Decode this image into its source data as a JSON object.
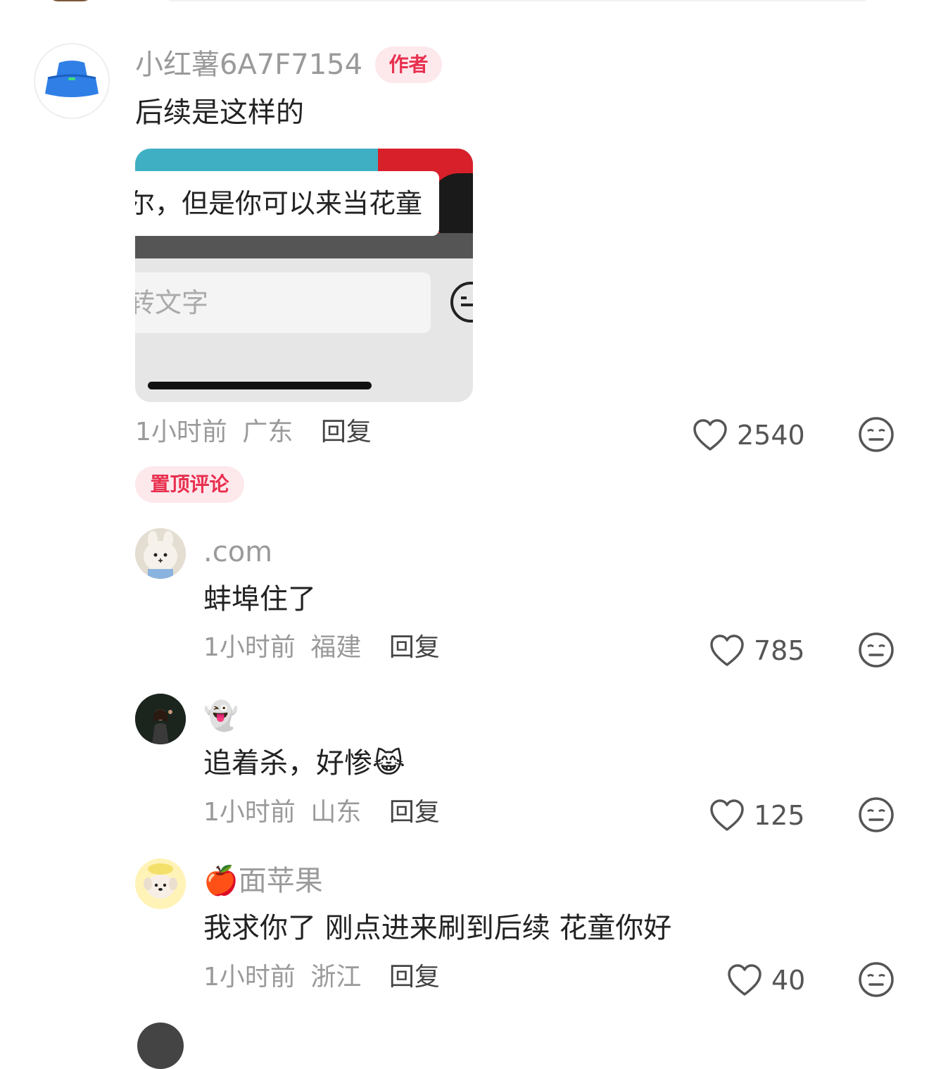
{
  "author_comment": {
    "name": "小红薯6A7F7154",
    "badge": "作者",
    "text": "后续是这样的",
    "image": {
      "bubble_text": "尔，但是你可以来当花童",
      "input_placeholder": "转文字"
    },
    "time": "1小时前",
    "location": "广东",
    "reply_label": "回复",
    "likes": "2540",
    "pinned_label": "置顶评论"
  },
  "replies": [
    {
      "name": ".com",
      "text": "蚌埠住了",
      "time": "1小时前",
      "location": "福建",
      "reply_label": "回复",
      "likes": "785"
    },
    {
      "name": "👻",
      "text": "追着杀，好惨😹",
      "time": "1小时前",
      "location": "山东",
      "reply_label": "回复",
      "likes": "125"
    },
    {
      "name": "🍎面苹果",
      "text": "我求你了 刚点进来刷到后续 花童你好",
      "time": "1小时前",
      "location": "浙江",
      "reply_label": "回复",
      "likes": "40"
    }
  ],
  "icons": {
    "like": "heart-outline-icon",
    "dislike": "neutral-face-icon"
  }
}
